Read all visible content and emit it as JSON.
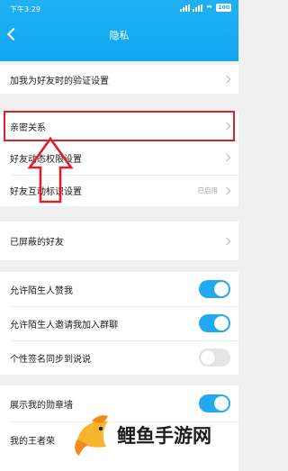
{
  "status_bar": {
    "time": "下午3:29",
    "battery": "100"
  },
  "header": {
    "title": "隐私"
  },
  "groups": {
    "g1": {
      "verify": "加我为好友时的验证设置"
    },
    "g2": {
      "intimate": "亲密关系",
      "dynamic": "好友动态权限设置",
      "interaction": "好友互动标识设置",
      "interaction_status": "已启用"
    },
    "g3": {
      "blocked": "已屏蔽的好友"
    },
    "g4": {
      "allow_like": "允许陌生人赞我",
      "allow_like_on": true,
      "allow_invite": "允许陌生人邀请我加入群聊",
      "allow_invite_on": true,
      "signature_sync": "个性签名同步到说说",
      "signature_sync_on": false
    },
    "g5": {
      "medal_wall": "展示我的勋章墙",
      "medal_wall_on": true,
      "king_glory": "我的王者荣"
    }
  },
  "annotation": {
    "highlight_color": "#e01e2b"
  },
  "watermark": {
    "text": "鲤鱼手游网",
    "colors": [
      "#f7b52c",
      "#f28a1a"
    ]
  }
}
